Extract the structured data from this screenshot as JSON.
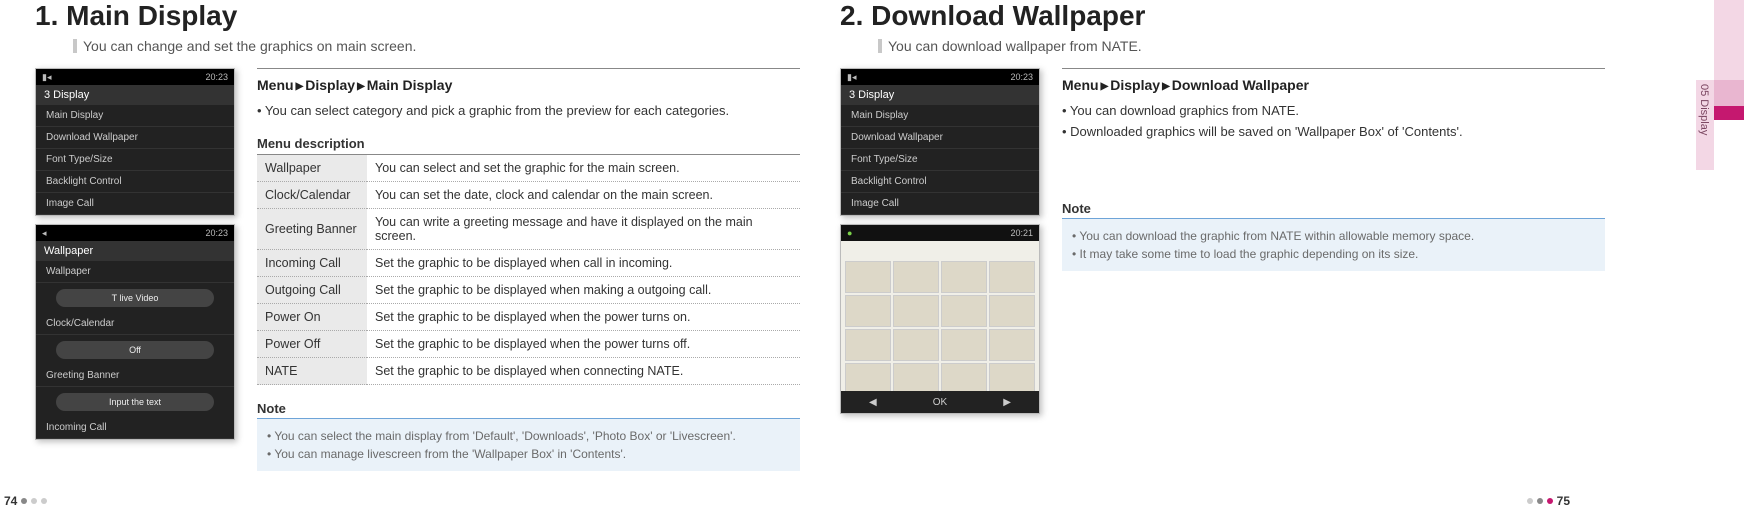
{
  "sideTab": {
    "label": "05 Display"
  },
  "pageLeft": {
    "number": "74",
    "heading": "1. Main Display",
    "intro": "You can change and set the graphics on main screen.",
    "breadcrumb": {
      "a": "Menu",
      "b": "Display",
      "c": "Main Display"
    },
    "bullet1": "• You can select category and pick a graphic from the preview for each categories.",
    "subhead": "Menu description",
    "table": [
      {
        "k": "Wallpaper",
        "v": "You can select and set the graphic for the main screen."
      },
      {
        "k": "Clock/Calendar",
        "v": "You can set the date, clock and calendar on the main screen."
      },
      {
        "k": "Greeting Banner",
        "v": "You can write a greeting message and have it displayed on the main screen."
      },
      {
        "k": "Incoming Call",
        "v": "Set the graphic to be displayed when call in incoming."
      },
      {
        "k": "Outgoing Call",
        "v": "Set the graphic to be displayed when making a outgoing call."
      },
      {
        "k": "Power On",
        "v": "Set the graphic to be displayed when the power turns on."
      },
      {
        "k": "Power Off",
        "v": "Set the graphic to be displayed when the power turns off."
      },
      {
        "k": "NATE",
        "v": "Set the graphic to be displayed when connecting NATE."
      }
    ],
    "noteHead": "Note",
    "note1": "• You can select the main display from 'Default', 'Downloads', 'Photo Box' or 'Livescreen'.",
    "note2": "• You can manage livescreen from the 'Wallpaper Box' in 'Contents'.",
    "phoneA": {
      "time": "20:23",
      "title": "3 Display",
      "items": [
        "Main Display",
        "Download Wallpaper",
        "Font Type/Size",
        "Backlight Control",
        "Image Call"
      ]
    },
    "phoneB": {
      "time": "20:23",
      "title": "Wallpaper",
      "rows": [
        "Wallpaper",
        "Clock/Calendar",
        "Greeting Banner",
        "Incoming Call"
      ],
      "btn1": "T live Video",
      "btn2": "Off",
      "btn3": "Input the text"
    }
  },
  "pageRight": {
    "number": "75",
    "heading": "2. Download Wallpaper",
    "intro": "You can download wallpaper from NATE.",
    "breadcrumb": {
      "a": "Menu",
      "b": "Display",
      "c": "Download Wallpaper"
    },
    "bullet1": "• You can download graphics from NATE.",
    "bullet2": "• Downloaded graphics will be saved on 'Wallpaper Box' of 'Contents'.",
    "noteHead": "Note",
    "note1": "• You can download the graphic from NATE within allowable memory space.",
    "note2": "• It may take some time to load the graphic depending on its size.",
    "phoneA": {
      "time": "20:23",
      "title": "3 Display",
      "items": [
        "Main Display",
        "Download Wallpaper",
        "Font Type/Size",
        "Backlight Control",
        "Image Call"
      ]
    },
    "phoneB": {
      "time": "20:21",
      "softL": "◀",
      "softC": "OK",
      "softR": "▶"
    }
  }
}
